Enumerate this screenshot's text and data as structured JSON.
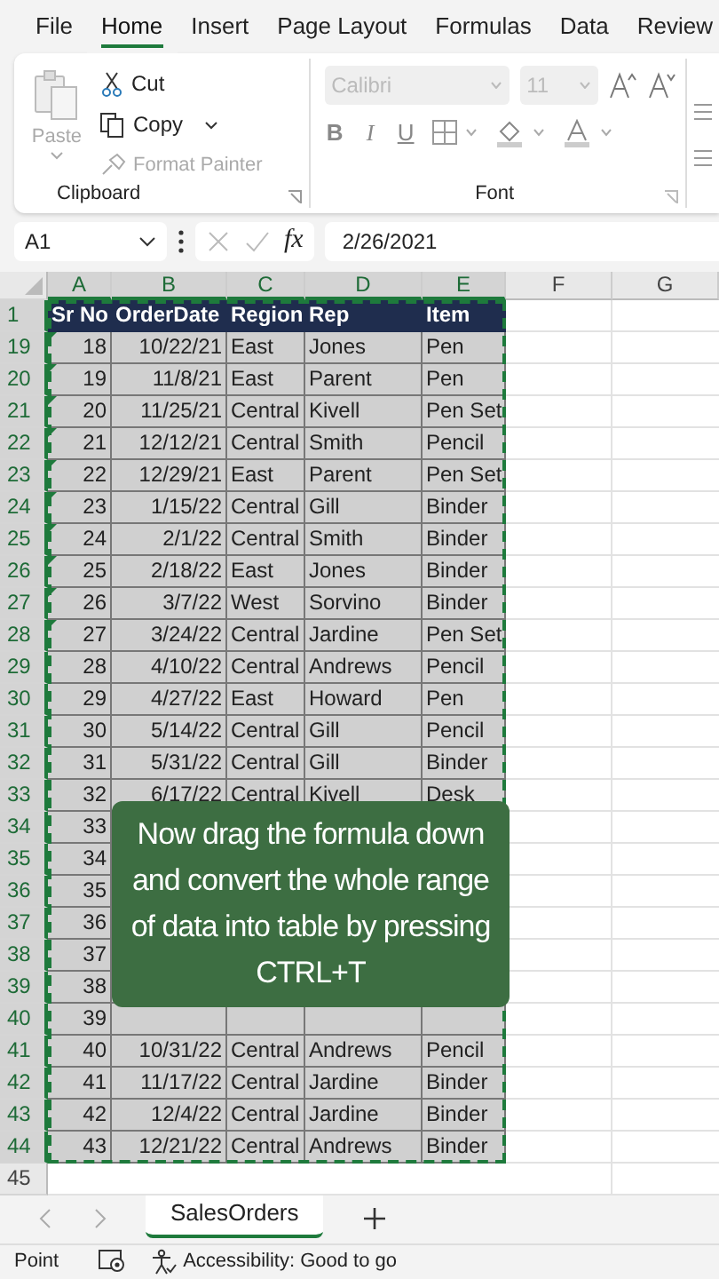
{
  "menu_tabs": [
    {
      "label": "File",
      "selected": false
    },
    {
      "label": "Home",
      "selected": true
    },
    {
      "label": "Insert",
      "selected": false
    },
    {
      "label": "Page Layout",
      "selected": false
    },
    {
      "label": "Formulas",
      "selected": false
    },
    {
      "label": "Data",
      "selected": false
    },
    {
      "label": "Review",
      "selected": false
    }
  ],
  "ribbon": {
    "paste_label": "Paste",
    "cut_label": "Cut",
    "copy_label": "Copy",
    "format_painter": {
      "label": "Format Painter",
      "disabled": true
    },
    "clipboard_group": "Clipboard",
    "font_name": {
      "value": "Calibri",
      "disabled": true
    },
    "font_size": {
      "value": "11",
      "disabled": true
    },
    "bold_glyph": "B",
    "italic_glyph": "I",
    "underline_glyph": "U",
    "font_group": "Font"
  },
  "formula_bar": {
    "name_box": "A1",
    "fx": "fx",
    "value": "2/26/2021"
  },
  "columns": [
    "A",
    "B",
    "C",
    "D",
    "E",
    "F",
    "G"
  ],
  "header_row": {
    "row": "1",
    "cells": [
      "Sr No",
      "OrderDate",
      "Region",
      "Rep",
      "Item"
    ]
  },
  "rows": [
    {
      "row": "19",
      "flag": true,
      "cells": [
        "18",
        "10/22/21",
        "East",
        "Jones",
        "Pen"
      ]
    },
    {
      "row": "20",
      "flag": true,
      "cells": [
        "19",
        "11/8/21",
        "East",
        "Parent",
        "Pen"
      ]
    },
    {
      "row": "21",
      "flag": true,
      "cells": [
        "20",
        "11/25/21",
        "Central",
        "Kivell",
        "Pen Set"
      ]
    },
    {
      "row": "22",
      "flag": true,
      "cells": [
        "21",
        "12/12/21",
        "Central",
        "Smith",
        "Pencil"
      ]
    },
    {
      "row": "23",
      "flag": true,
      "cells": [
        "22",
        "12/29/21",
        "East",
        "Parent",
        "Pen Set"
      ]
    },
    {
      "row": "24",
      "flag": true,
      "cells": [
        "23",
        "1/15/22",
        "Central",
        "Gill",
        "Binder"
      ]
    },
    {
      "row": "25",
      "flag": true,
      "cells": [
        "24",
        "2/1/22",
        "Central",
        "Smith",
        "Binder"
      ]
    },
    {
      "row": "26",
      "flag": true,
      "cells": [
        "25",
        "2/18/22",
        "East",
        "Jones",
        "Binder"
      ]
    },
    {
      "row": "27",
      "flag": true,
      "cells": [
        "26",
        "3/7/22",
        "West",
        "Sorvino",
        "Binder"
      ]
    },
    {
      "row": "28",
      "flag": true,
      "cells": [
        "27",
        "3/24/22",
        "Central",
        "Jardine",
        "Pen Set"
      ]
    },
    {
      "row": "29",
      "flag": false,
      "cells": [
        "28",
        "4/10/22",
        "Central",
        "Andrews",
        "Pencil"
      ]
    },
    {
      "row": "30",
      "flag": false,
      "cells": [
        "29",
        "4/27/22",
        "East",
        "Howard",
        "Pen"
      ]
    },
    {
      "row": "31",
      "flag": false,
      "cells": [
        "30",
        "5/14/22",
        "Central",
        "Gill",
        "Pencil"
      ]
    },
    {
      "row": "32",
      "flag": false,
      "cells": [
        "31",
        "5/31/22",
        "Central",
        "Gill",
        "Binder"
      ]
    },
    {
      "row": "33",
      "flag": false,
      "cells": [
        "32",
        "6/17/22",
        "Central",
        "Kivell",
        "Desk"
      ]
    },
    {
      "row": "34",
      "flag": false,
      "cells": [
        "33"
      ]
    },
    {
      "row": "35",
      "flag": false,
      "cells": [
        "34"
      ]
    },
    {
      "row": "36",
      "flag": false,
      "cells": [
        "35"
      ]
    },
    {
      "row": "37",
      "flag": false,
      "cells": [
        "36"
      ]
    },
    {
      "row": "38",
      "flag": false,
      "cells": [
        "37"
      ]
    },
    {
      "row": "39",
      "flag": false,
      "cells": [
        "38"
      ]
    },
    {
      "row": "40",
      "flag": false,
      "cells": [
        "39"
      ]
    },
    {
      "row": "41",
      "flag": false,
      "cells": [
        "40",
        "10/31/22",
        "Central",
        "Andrews",
        "Pencil"
      ]
    },
    {
      "row": "42",
      "flag": false,
      "cells": [
        "41",
        "11/17/22",
        "Central",
        "Jardine",
        "Binder"
      ]
    },
    {
      "row": "43",
      "flag": false,
      "cells": [
        "42",
        "12/4/22",
        "Central",
        "Jardine",
        "Binder"
      ]
    },
    {
      "row": "44",
      "flag": false,
      "cells": [
        "43",
        "12/21/22",
        "Central",
        "Andrews",
        "Binder"
      ]
    }
  ],
  "empty_row": "45",
  "caption": "Now drag the formula down and convert the whole range of data into table by pressing CTRL+T",
  "sheet_tabs": [
    {
      "label": "SalesOrders",
      "selected": true
    }
  ],
  "status_bar": {
    "mode": "Point",
    "accessibility": "Accessibility: Good to go"
  }
}
